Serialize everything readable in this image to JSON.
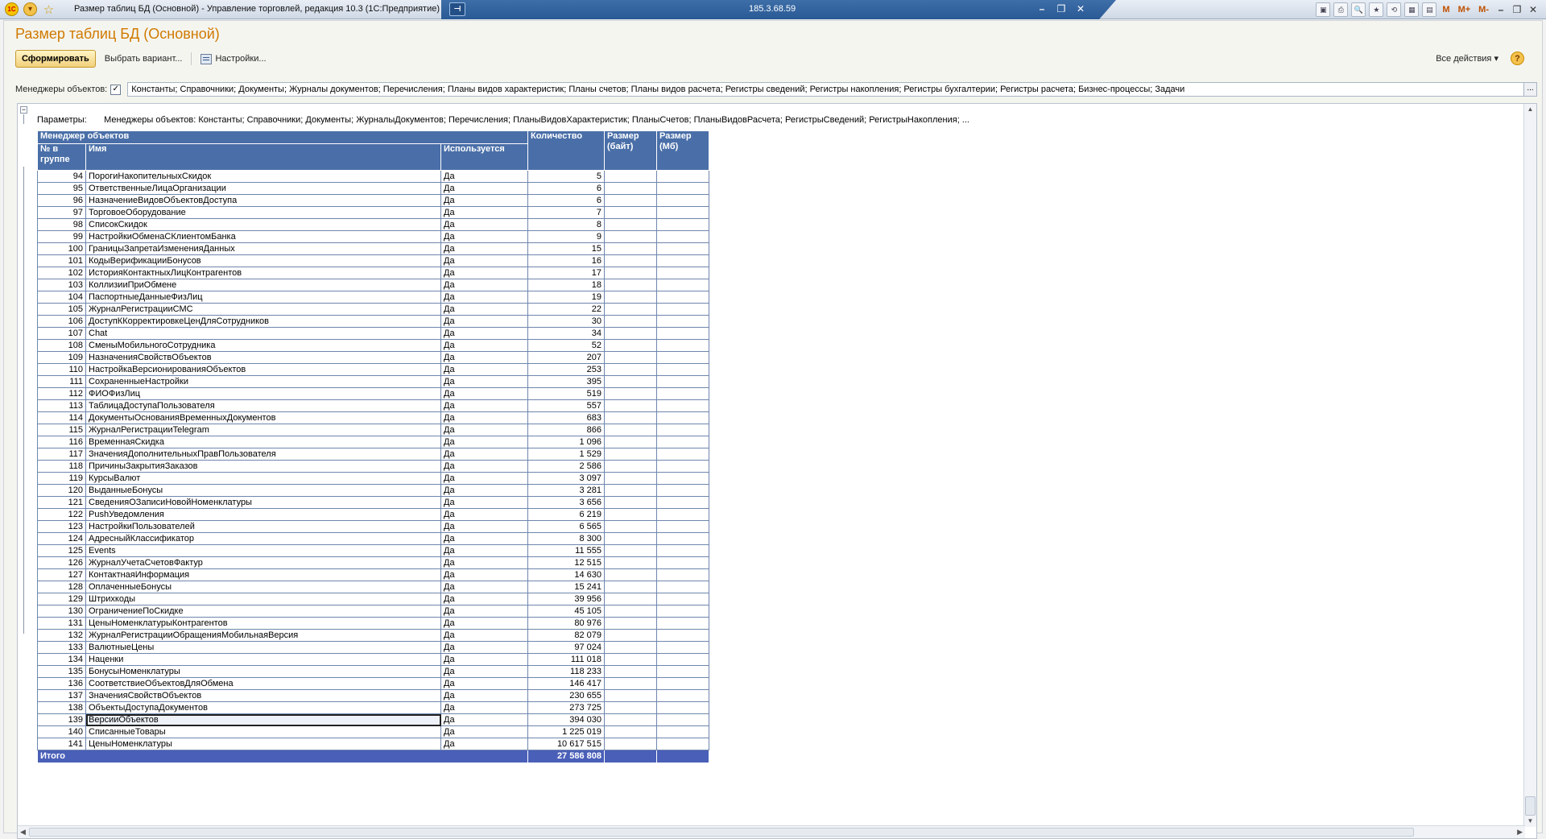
{
  "window": {
    "title": "Размер таблиц БД (Основной) - Управление торговлей, редакция 10.3  (1С:Предприятие)",
    "remote_host": "185.3.68.59",
    "toolbar_text_buttons": [
      "M",
      "M+",
      "M-"
    ]
  },
  "form": {
    "title": "Размер таблиц БД (Основной)",
    "generate_button": "Сформировать",
    "choose_variant_button": "Выбрать вариант...",
    "settings_button": "Настройки...",
    "all_actions_button": "Все действия",
    "help_button": "?",
    "filter_label": "Менеджеры объектов:",
    "filter_value": "Константы; Справочники; Документы; Журналы документов; Перечисления; Планы видов характеристик; Планы счетов; Планы видов расчета; Регистры сведений; Регистры накопления; Регистры бухгалтерии; Регистры расчета; Бизнес-процессы; Задачи",
    "filter_more": "...",
    "checkbox_mark": "✓"
  },
  "report": {
    "params_label": "Параметры:",
    "params_value": "Менеджеры объектов: Константы; Справочники; Документы; ЖурналыДокументов; Перечисления; ПланыВидовХарактеристик; ПланыСчетов; ПланыВидовРасчета; РегистрыСведений; РегистрыНакопления; ...",
    "headers": {
      "group": "Менеджер объектов",
      "num": "№ в группе",
      "name": "Имя",
      "used": "Используется",
      "count": "Количество",
      "size_bytes": "Размер (байт)",
      "size_mb": "Размер (Мб)"
    },
    "rows": [
      [
        "94",
        "ПорогиНакопительныхСкидок",
        "Да",
        "5"
      ],
      [
        "95",
        "ОтветственныеЛицаОрганизации",
        "Да",
        "6"
      ],
      [
        "96",
        "НазначениеВидовОбъектовДоступа",
        "Да",
        "6"
      ],
      [
        "97",
        "ТорговоеОборудование",
        "Да",
        "7"
      ],
      [
        "98",
        "СписокСкидок",
        "Да",
        "8"
      ],
      [
        "99",
        "НастройкиОбменаСКлиентомБанка",
        "Да",
        "9"
      ],
      [
        "100",
        "ГраницыЗапретаИзмененияДанных",
        "Да",
        "15"
      ],
      [
        "101",
        "КодыВерификацииБонусов",
        "Да",
        "16"
      ],
      [
        "102",
        "ИсторияКонтактныхЛицКонтрагентов",
        "Да",
        "17"
      ],
      [
        "103",
        "КоллизииПриОбмене",
        "Да",
        "18"
      ],
      [
        "104",
        "ПаспортныеДанныеФизЛиц",
        "Да",
        "19"
      ],
      [
        "105",
        "ЖурналРегистрацииСМС",
        "Да",
        "22"
      ],
      [
        "106",
        "ДоступККорректировкеЦенДляСотрудников",
        "Да",
        "30"
      ],
      [
        "107",
        "Chat",
        "Да",
        "34"
      ],
      [
        "108",
        "СменыМобильногоСотрудника",
        "Да",
        "52"
      ],
      [
        "109",
        "НазначенияСвойствОбъектов",
        "Да",
        "207"
      ],
      [
        "110",
        "НастройкаВерсионированияОбъектов",
        "Да",
        "253"
      ],
      [
        "111",
        "СохраненныеНастройки",
        "Да",
        "395"
      ],
      [
        "112",
        "ФИОФизЛиц",
        "Да",
        "519"
      ],
      [
        "113",
        "ТаблицаДоступаПользователя",
        "Да",
        "557"
      ],
      [
        "114",
        "ДокументыОснованияВременныхДокументов",
        "Да",
        "683"
      ],
      [
        "115",
        "ЖурналРегистрацииTelegram",
        "Да",
        "866"
      ],
      [
        "116",
        "ВременнаяСкидка",
        "Да",
        "1 096"
      ],
      [
        "117",
        "ЗначенияДополнительныхПравПользователя",
        "Да",
        "1 529"
      ],
      [
        "118",
        "ПричиныЗакрытияЗаказов",
        "Да",
        "2 586"
      ],
      [
        "119",
        "КурсыВалют",
        "Да",
        "3 097"
      ],
      [
        "120",
        "ВыданныеБонусы",
        "Да",
        "3 281"
      ],
      [
        "121",
        "СведенияОЗаписиНовойНоменклатуры",
        "Да",
        "3 656"
      ],
      [
        "122",
        "PushУведомления",
        "Да",
        "6 219"
      ],
      [
        "123",
        "НастройкиПользователей",
        "Да",
        "6 565"
      ],
      [
        "124",
        "АдресныйКлассификатор",
        "Да",
        "8 300"
      ],
      [
        "125",
        "Events",
        "Да",
        "11 555"
      ],
      [
        "126",
        "ЖурналУчетаСчетовФактур",
        "Да",
        "12 515"
      ],
      [
        "127",
        "КонтактнаяИнформация",
        "Да",
        "14 630"
      ],
      [
        "128",
        "ОплаченныеБонусы",
        "Да",
        "15 241"
      ],
      [
        "129",
        "Штрихкоды",
        "Да",
        "39 956"
      ],
      [
        "130",
        "ОграничениеПоСкидке",
        "Да",
        "45 105"
      ],
      [
        "131",
        "ЦеныНоменклатурыКонтрагентов",
        "Да",
        "80 976"
      ],
      [
        "132",
        "ЖурналРегистрацииОбращенияМобильнаяВерсия",
        "Да",
        "82 079"
      ],
      [
        "133",
        "ВалютныеЦены",
        "Да",
        "97 024"
      ],
      [
        "134",
        "Наценки",
        "Да",
        "111 018"
      ],
      [
        "135",
        "БонусыНоменклатуры",
        "Да",
        "118 233"
      ],
      [
        "136",
        "СоответствиеОбъектовДляОбмена",
        "Да",
        "146 417"
      ],
      [
        "137",
        "ЗначенияСвойствОбъектов",
        "Да",
        "230 655"
      ],
      [
        "138",
        "ОбъектыДоступаДокументов",
        "Да",
        "273 725"
      ],
      [
        "139",
        "ВерсииОбъектов",
        "Да",
        "394 030"
      ],
      [
        "140",
        "СписанныеТовары",
        "Да",
        "1 225 019"
      ],
      [
        "141",
        "ЦеныНоменклатуры",
        "Да",
        "10 617 515"
      ]
    ],
    "selected_row": "139",
    "total_label": "Итого",
    "total_count": "27 586 808"
  },
  "colors": {
    "header_bg": "#4a6fa8",
    "total_bg": "#4a5fb8",
    "title_orange": "#d07a00"
  }
}
